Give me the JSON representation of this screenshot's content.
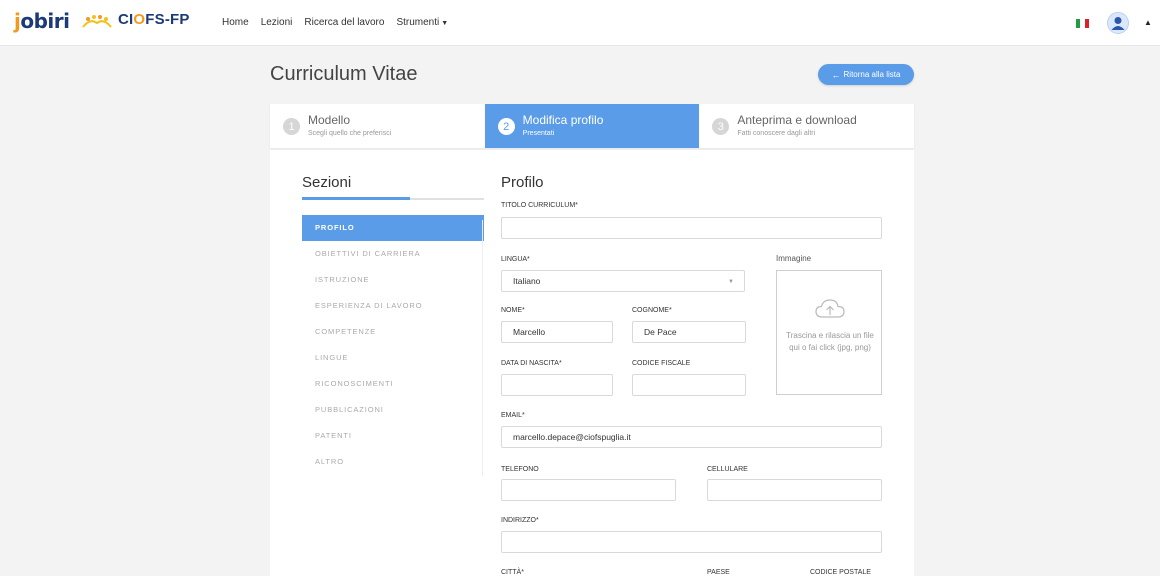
{
  "header": {
    "brand_left": "jobiri",
    "brand_right_prefix": "CI",
    "brand_right_o": "O",
    "brand_right_suffix": "FS-FP",
    "nav": [
      "Home",
      "Lezioni",
      "Ricerca del lavoro",
      "Strumenti"
    ],
    "flag_colors": [
      "#1f9d45",
      "#ffffff",
      "#d8232a"
    ]
  },
  "page": {
    "title": "Curriculum Vitae",
    "back_button": "Ritorna alla lista"
  },
  "steps": [
    {
      "num": "1",
      "title": "Modello",
      "subtitle": "Scegli quello che preferisci",
      "active": false
    },
    {
      "num": "2",
      "title": "Modifica profilo",
      "subtitle": "Presentati",
      "active": true
    },
    {
      "num": "3",
      "title": "Anteprima e download",
      "subtitle": "Fatti conoscere dagli altri",
      "active": false
    }
  ],
  "sections": {
    "title": "Sezioni",
    "items": [
      "PROFILO",
      "OBIETTIVI DI CARRIERA",
      "ISTRUZIONE",
      "ESPERIENZA DI LAVORO",
      "COMPETENZE",
      "LINGUE",
      "RICONOSCIMENTI",
      "PUBBLICAZIONI",
      "PATENTI",
      "ALTRO"
    ]
  },
  "form": {
    "title": "Profilo",
    "titolo_label": "TITOLO CURRICULUM*",
    "titolo_value": "",
    "lingua_label": "LINGUA*",
    "lingua_value": "Italiano",
    "immagine_label": "Immagine",
    "dropzone_text": "Trascina e rilascia un file qui o fai click (jpg, png)",
    "nome_label": "NOME*",
    "nome_value": "Marcello",
    "cognome_label": "COGNOME*",
    "cognome_value": "De Pace",
    "nascita_label": "DATA DI NASCITA*",
    "nascita_value": "",
    "cf_label": "CODICE FISCALE",
    "cf_value": "",
    "email_label": "EMAIL*",
    "email_value": "marcello.depace@ciofspuglia.it",
    "telefono_label": "TELEFONO",
    "telefono_value": "",
    "cellulare_label": "CELLULARE",
    "cellulare_value": "",
    "indirizzo_label": "INDIRIZZO*",
    "indirizzo_value": "",
    "citta_label": "CITTÀ*",
    "paese_label": "PAESE",
    "cap_label": "CODICE POSTALE"
  },
  "colors": {
    "accent": "#5a9ce8",
    "brand_navy": "#1b3a78",
    "brand_orange": "#f39a1e"
  }
}
